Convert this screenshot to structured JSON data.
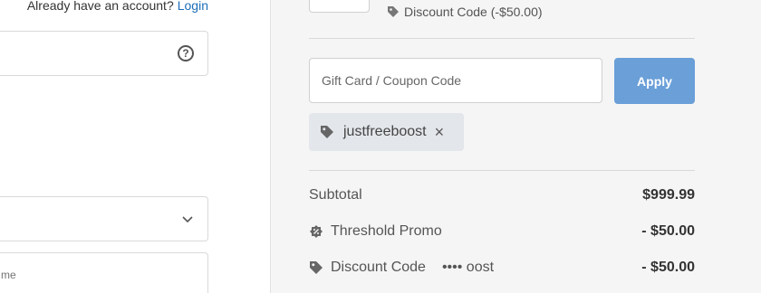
{
  "account": {
    "prompt": "Already have an account?",
    "login_label": "Login"
  },
  "contact": {
    "phone_help_icon": "help-circle-icon",
    "field_name_partial": "me",
    "select_chevron": "chevron-down-icon"
  },
  "order": {
    "discount_line": "Discount Code (-$50.00)"
  },
  "coupon": {
    "placeholder": "Gift Card / Coupon Code",
    "apply_label": "Apply",
    "applied_code": "justfreeboost",
    "remove_icon": "×"
  },
  "summary": {
    "subtotal_label": "Subtotal",
    "subtotal_value": "$999.99",
    "threshold_label": "Threshold Promo",
    "threshold_value": "- $50.00",
    "discount_label": "Discount Code",
    "discount_masked": "•••• oost",
    "discount_value": "- $50.00"
  },
  "colors": {
    "accent_button": "#6a9fd8",
    "link": "#1c6fb8",
    "right_panel_bg": "#f5f5f5",
    "tag_bg": "#e3e6ea"
  }
}
